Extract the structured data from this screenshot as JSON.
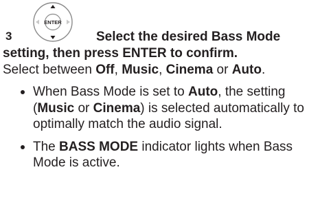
{
  "step": {
    "number": "3",
    "remote_button_label": "ENTER",
    "heading_line1": "Select the desired Bass Mode",
    "heading_line2": "setting, then press ENTER to confirm.",
    "intro_prefix": "Select between ",
    "options": [
      "Off",
      "Music",
      "Cinema",
      "Auto"
    ],
    "sep1": ", ",
    "sep2": ", ",
    "sep3": " or ",
    "intro_suffix": "."
  },
  "bullets": [
    {
      "p1": "When Bass Mode is set to ",
      "b1": "Auto",
      "p2": ", the setting (",
      "b2": "Music",
      "p3": " or ",
      "b3": "Cinema",
      "p4": ") is selected automatically to optimally match the audio signal."
    },
    {
      "p1": "The ",
      "b1": "BASS MODE",
      "p2": " indicator lights when Bass Mode is active."
    }
  ]
}
